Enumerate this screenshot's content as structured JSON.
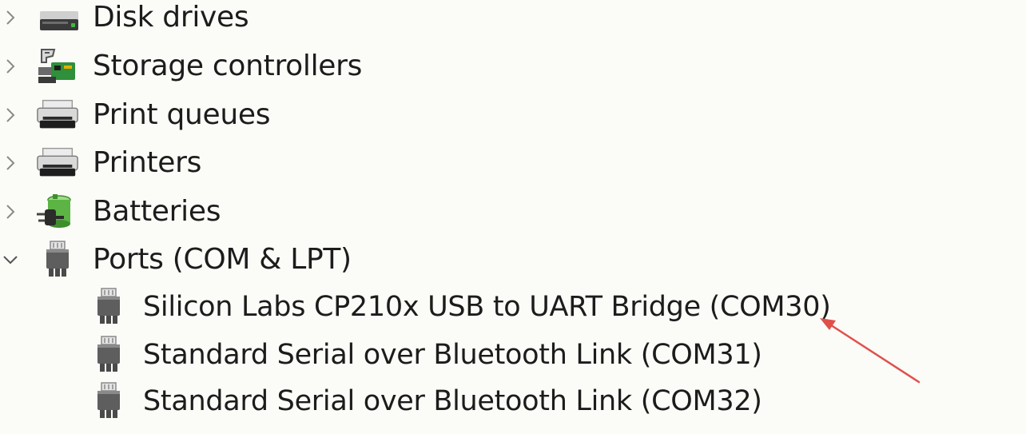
{
  "tree": {
    "categories": [
      {
        "label": "Disk drives",
        "icon": "disk-drive-icon",
        "expanded": false
      },
      {
        "label": "Storage controllers",
        "icon": "storage-controller-icon",
        "expanded": false
      },
      {
        "label": "Print queues",
        "icon": "printer-icon",
        "expanded": false
      },
      {
        "label": "Printers",
        "icon": "printer-icon",
        "expanded": false
      },
      {
        "label": "Batteries",
        "icon": "battery-icon",
        "expanded": false
      },
      {
        "label": "Ports (COM & LPT)",
        "icon": "port-icon",
        "expanded": true
      }
    ],
    "ports_children": [
      {
        "label": "Silicon Labs CP210x USB to UART Bridge (COM30)",
        "icon": "port-icon"
      },
      {
        "label": "Standard Serial over Bluetooth Link (COM31)",
        "icon": "port-icon"
      },
      {
        "label": "Standard Serial over Bluetooth Link (COM32)",
        "icon": "port-icon"
      }
    ]
  },
  "annotation": {
    "arrow_color": "#e0504b",
    "points_to": "Silicon Labs CP210x USB to UART Bridge (COM30)"
  }
}
